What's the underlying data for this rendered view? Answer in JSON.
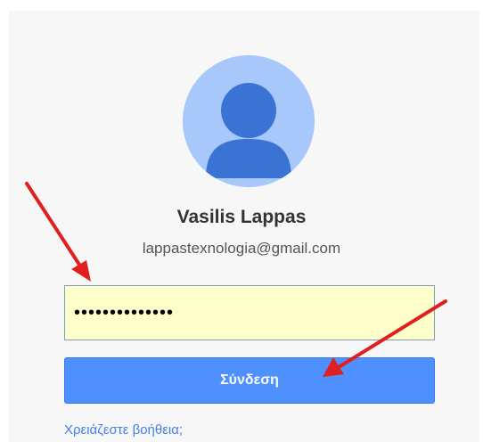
{
  "account": {
    "name": "Vasilis Lappas",
    "email": "lappastexnologia@gmail.com",
    "avatar_icon": "user-silhouette-icon",
    "avatar_colors": {
      "background": "#a8c7fa",
      "figure": "#3b73d4"
    }
  },
  "password_field": {
    "value": "••••••••••••••"
  },
  "signin": {
    "label": "Σύνδεση"
  },
  "help": {
    "label": "Χρειάζεστε βοήθεια;"
  },
  "annotations": {
    "arrow_icon": "red-arrow-icon",
    "color": "#e02020"
  },
  "colors": {
    "input_background": "#ffffcc",
    "button": "#4d90fe",
    "link": "#427fed"
  }
}
